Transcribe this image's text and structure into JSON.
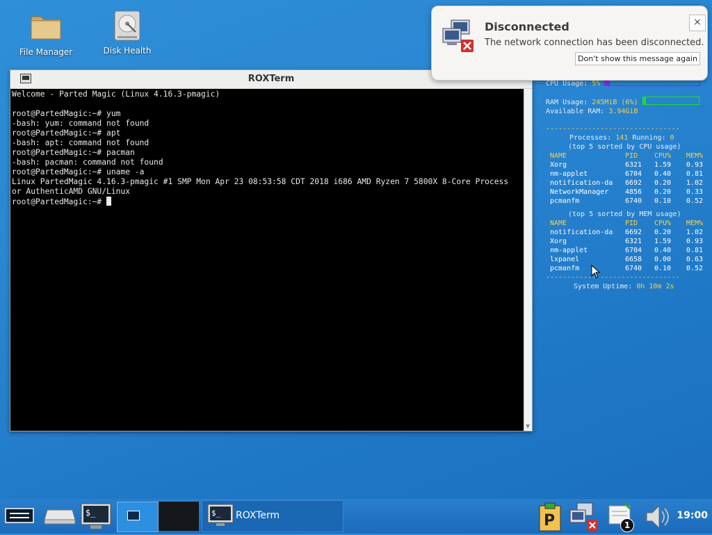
{
  "desktop": {
    "icons": [
      {
        "label": "File Manager",
        "icon": "folder-icon"
      },
      {
        "label": "Disk Health",
        "icon": "hard-disk-icon"
      }
    ]
  },
  "window": {
    "title": "ROXTerm",
    "terminal_lines": [
      "Welcome - Parted Magic (Linux 4.16.3-pmagic)",
      "",
      "root@PartedMagic:~# yum",
      "-bash: yum: command not found",
      "root@PartedMagic:~# apt",
      "-bash: apt: command not found",
      "root@PartedMagic:~# pacman",
      "-bash: pacman: command not found",
      "root@PartedMagic:~# uname -a",
      "Linux PartedMagic 4.16.3-pmagic #1 SMP Mon Apr 23 08:53:58 CDT 2018 i686 AMD Ryzen 7 5800X 8-Core Process",
      "or AuthenticAMD GNU/Linux"
    ],
    "prompt": "root@PartedMagic:~# "
  },
  "notification": {
    "title": "Disconnected",
    "body": "The network connection has been disconnected.",
    "button": "Don't show this message again",
    "close": "×"
  },
  "conky": {
    "cpu_label": "CPU Usage:",
    "cpu_value": "5%",
    "cpu_fraction": 0.05,
    "ram_label": "RAM Usage:",
    "ram_value": "245MiB (6%)",
    "ram_fraction": 0.06,
    "avail_label": "Available RAM:",
    "avail_value": "3.94GiB",
    "separator": "--------------------------------",
    "proc_label": "Processes:",
    "proc_value": "141",
    "running_label": "Running:",
    "running_value": "0",
    "cpu_sort_header": "(top 5 sorted by CPU usage)",
    "mem_sort_header": "(top 5 sorted by MEM usage)",
    "columns": [
      "NAME",
      "PID",
      "CPU%",
      "MEM%"
    ],
    "top_cpu": [
      [
        "Xorg",
        "6321",
        "1.59",
        "0.93"
      ],
      [
        "nm-applet",
        "6704",
        "0.40",
        "0.81"
      ],
      [
        "notification-da",
        "6692",
        "0.20",
        "1.02"
      ],
      [
        "NetworkManager",
        "4856",
        "0.20",
        "0.33"
      ],
      [
        "pcmanfm",
        "6740",
        "0.10",
        "0.52"
      ]
    ],
    "top_mem": [
      [
        "notification-da",
        "6692",
        "0.20",
        "1.02"
      ],
      [
        "Xorg",
        "6321",
        "1.59",
        "0.93"
      ],
      [
        "nm-applet",
        "6704",
        "0.40",
        "0.81"
      ],
      [
        "lxpanel",
        "6658",
        "0.00",
        "0.63"
      ],
      [
        "pcmanfm",
        "6740",
        "0.10",
        "0.52"
      ]
    ],
    "uptime_label": "System Uptime:",
    "uptime_value": "0h 10m 2s"
  },
  "taskbar": {
    "task_label": "ROXTerm",
    "clock": "19:00",
    "notification_count": "1",
    "tray_icons": [
      "parted-magic-icon",
      "network-disconnected-icon",
      "notification-icon",
      "volume-icon"
    ]
  },
  "colors": {
    "accent_yellow": "#f5d24a",
    "cpu_bar": "#8a2be2",
    "ram_bar": "#22dd22",
    "error_red": "#d32f2f"
  }
}
